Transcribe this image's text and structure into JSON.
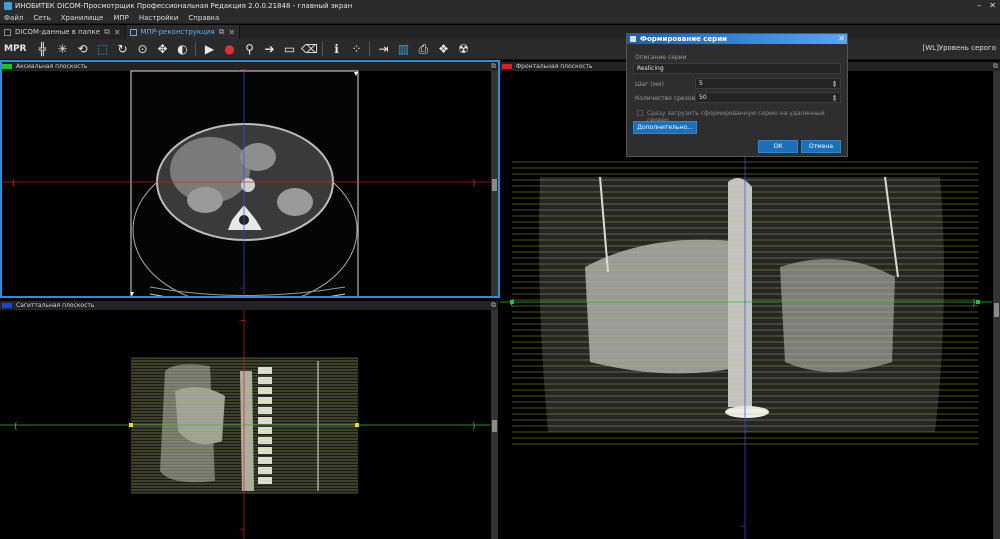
{
  "window": {
    "title": "ИНОБИТЕК DICOM-Просмотрщик Профессиональная Редакция 2.0.0.21848 - главный экран",
    "minimize": "–",
    "close": "✕"
  },
  "menu": [
    "Файл",
    "Сеть",
    "Хранилище",
    "МПР",
    "Настройки",
    "Справка"
  ],
  "tabs": [
    {
      "label": "DICOM-данные в папке",
      "active": false
    },
    {
      "label": "МПР-реконструкция",
      "active": true
    }
  ],
  "toolbar": {
    "mode_label": "MPR",
    "wl_label": "[WL]Уровень серого",
    "icons": [
      "crosshair-icon",
      "scroll-icon",
      "rotate3d-icon",
      "rotate-icon",
      "zoom-icon",
      "pan-icon",
      "contrast-icon",
      "play-icon",
      "record-icon",
      "pin-icon",
      "arrow-icon",
      "ruler-icon",
      "eraser-icon",
      "info-icon",
      "dots-icon",
      "export-icon",
      "series-icon",
      "print-icon",
      "volume-icon",
      "radiation-icon"
    ]
  },
  "viewports": {
    "axial": {
      "label": "Аксиальная плоскость",
      "color": "#22c020"
    },
    "sagittal": {
      "label": "Сагиттальная плоскость",
      "color": "#2040e0"
    },
    "frontal": {
      "label": "Фронтальная плоскость",
      "color": "#e02020"
    }
  },
  "dialog": {
    "title": "Формирование серии",
    "series_desc_label": "Описание серии",
    "series_desc_value": "Reslicing",
    "step_label": "Шаг (мм)",
    "step_value": "5",
    "count_label": "Количество срезов",
    "count_value": "50",
    "checkbox_label": "Сразу загрузить сформированную серию на удаленный сервер",
    "advanced_button": "Дополнительно...",
    "ok_button": "ОК",
    "cancel_button": "Отмена"
  },
  "colors": {
    "accent": "#2a8fd8",
    "axial_line": "#d02020",
    "vertical_line": "#3050e0",
    "sagittal_line": "#20c040",
    "slab_lines": "#c8c85a"
  }
}
